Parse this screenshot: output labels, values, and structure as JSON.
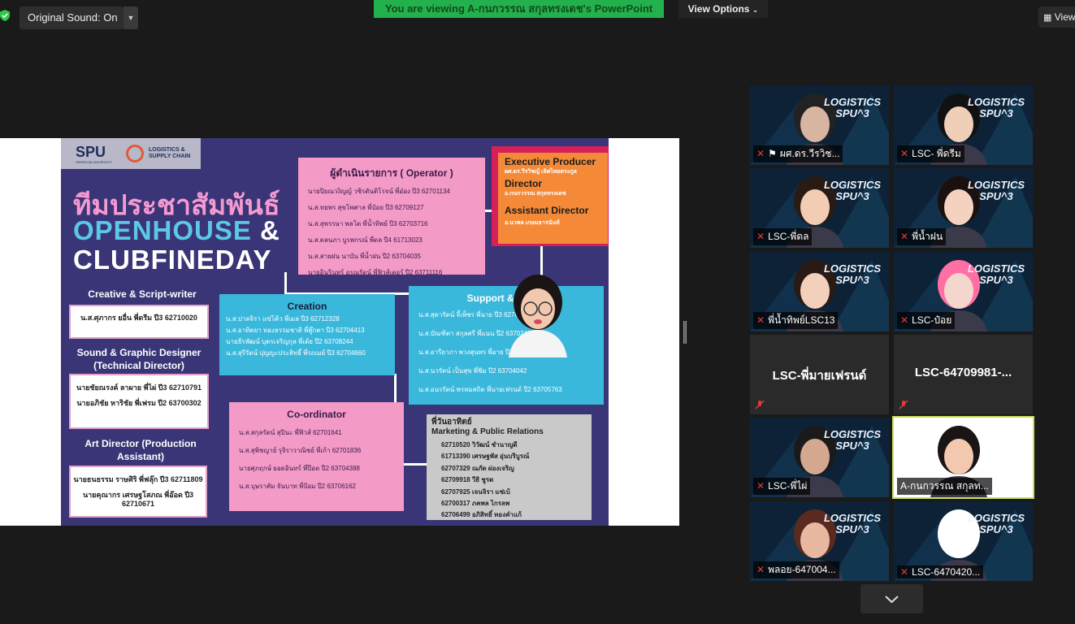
{
  "toolbar": {
    "original_sound_label": "Original Sound: On",
    "viewing_banner": "You are viewing A-กนกวรรณ สกุลทรงเดช's PowerPoint",
    "view_options_label": "View Options",
    "view_right_label": "View"
  },
  "slide": {
    "logo": {
      "spu": "SPU",
      "spu_sub": "SRIPATUM UNIVERSITY",
      "dept": "LOGISTICS & SUPPLY CHAIN"
    },
    "title_thai": "ทีมประชาสัมพันธ์",
    "title_openhouse": "OPENHOUSE",
    "title_amp": "&",
    "title_clubfineday": "CLUBFINEDAY",
    "operator": {
      "title": "ผู้ดำเนินรายการ ( Operator )",
      "lines": [
        "นายปิยณวงิญญ์ วชิรตันติโรจน์ พี่อ๋อง ปี3 62701134",
        "น.ส.ทยพร สุขโพศาล พี่ป๋อย ปี3 62709127",
        "น.ส.สุพรรษา พลโต พี่น้ำทิพย์ ปี3 62703716",
        "น.ส.ตลนภา บูรพกรณ์ พี่ดล ปี4 61713023",
        "น.ส.สายฝน นาบัน พี่น้ำฝน ปี2 63704035",
        "นายอินรินทร์ อรุณรัตน์ พี่ฟิวส์เตอร์ ปี2 63711116"
      ]
    },
    "executive": {
      "producer_label": "Executive Producer",
      "producer_name": "ผศ.ดร.วีรวิชญ์ เลิศไทยตระกูล",
      "director_label": "Director",
      "director_name": "อ.กนกวรรณ สกุลทรงเดช",
      "assistant_label": "Assistant Director",
      "assistant_name": "อ.นวพล เกษมธารนันท์"
    },
    "creative": {
      "heading": "Creative & Script-writer",
      "names": "น.ส.ศุภากร ยอื่น พี่ดรีม ปี3 62710020"
    },
    "sound": {
      "heading": "Sound & Graphic Designer (Technical Director)",
      "names": [
        "นายชัยณรงค์ ลาผาย พี่ไผ่ ปี3 62710791",
        "นายอภิชัย หาริชัย พี่เฟรม ปี2 63700302"
      ]
    },
    "art": {
      "heading": "Art Director (Production Assistant)",
      "names": [
        "นายธนธรรม ราษศิริ พี่ฟลุ๊ก ปี3 62711809",
        "นายคุณากร เศรษฐโสภณ พี่อ๊อด ปี3 62710671"
      ]
    },
    "creation": {
      "title": "Creation",
      "lines": [
        "น.ส.ปาลจิรา แซ่โค้ว พี่เมล ปี3 62712328",
        "น.ส.อาทิตยา ทองธรรมชาติ พี่ตู๊กตา ปี3 62704413",
        "นายธีรพัฒน์ บุตรเจริญกุล พี่เต้ย ปี2 63708244",
        "น.ส.สุรีรัตน์ ปุญญะประสิทธิ์ พี่รถเมย์ ปี3 62704660"
      ]
    },
    "support": {
      "title": "Support & admin",
      "lines": [
        "น.ส.สุดารัตน์ จี้เพ็ชร พี่นาย ปี3 62704519",
        "น.ส.บัณฑิตา สกุลศรี พี่แนน ปี2 63702491",
        "น.ส.อารียาภา พวงสุนทร พี่อาย ปี2 63704953",
        "น.ส.นวรัตน์ เป็นสุข พี่ชิม ปี2 63704042",
        "น.ส.อนรรัตน์ พรหมสถิต พี่นายเฟรนด์ ปี2 63705763"
      ]
    },
    "coordinator": {
      "title": "Co-ordinator",
      "lines": [
        "น.ส.สกุลรัตน์ สุปินะ พี่ฟิวส์ 62701641",
        "น.ส.สุพิชญาย์ รุจิราวาณิชย์ พี่เก้า 62701836",
        "นายศุภฤกษ์ ยอดอินทร์ พี่ป๊อด ปี2 63704388",
        "น.ส.บุษราคัม จันบาท พี่ป้อม ปี2 63706162"
      ]
    },
    "marketing": {
      "title1": "พี่วันอาทิตย์",
      "title2": "Marketing & Public Relations",
      "lines": [
        "62710520 วิวัฒน์ ชำนาญดี",
        "61713390 เศรษฐพัส อุ่นบริบูรณ์",
        "62707329 ณภัต ผ่องเจริญ",
        "62709918 วีธิ ชูรต",
        "62707925 เจนจิรา แซ่เบ้",
        "62700317 ภคพล ไกรลพ",
        "62706499 อภิสิทธิ์ ทองคำแก้"
      ]
    }
  },
  "gallery": [
    {
      "name": "ผศ.ดร.วีรวิช...",
      "pinned": true
    },
    {
      "name": "LSC- พี่ดรีม"
    },
    {
      "name": "LSC-พี่ดล"
    },
    {
      "name": "พี่น้ำฝน"
    },
    {
      "name": "พี่น้ำทิพย์LSC13"
    },
    {
      "name": "LSC-ป๋อย"
    },
    {
      "name": "LSC-พี่มายเฟรนด์",
      "video_off": true
    },
    {
      "name": "LSC-64709981-...",
      "video_off": true
    },
    {
      "name": "LSC-พี่ไผ่"
    },
    {
      "name": "A-กนกวรรณ สกุลท...",
      "active": true
    },
    {
      "name": "พลอย-647004..."
    },
    {
      "name": "LSC-6470420..."
    }
  ],
  "tile_logo": {
    "line1": "LOGISTICS",
    "line2": "SPU^3"
  },
  "colors": {
    "accent_green": "#22b14c",
    "active_outline": "#c8e25a",
    "slide_bg": "#3a3577",
    "pink": "#f39ac6",
    "cyan": "#3ab8dc",
    "orange": "#f48a38"
  },
  "icons": {
    "security": "shield-check-icon",
    "caret": "chevron-down-icon",
    "gallery": "grid-icon",
    "mic_muted": "mic-muted-icon",
    "pin": "pin-icon",
    "more": "chevron-down-icon"
  }
}
